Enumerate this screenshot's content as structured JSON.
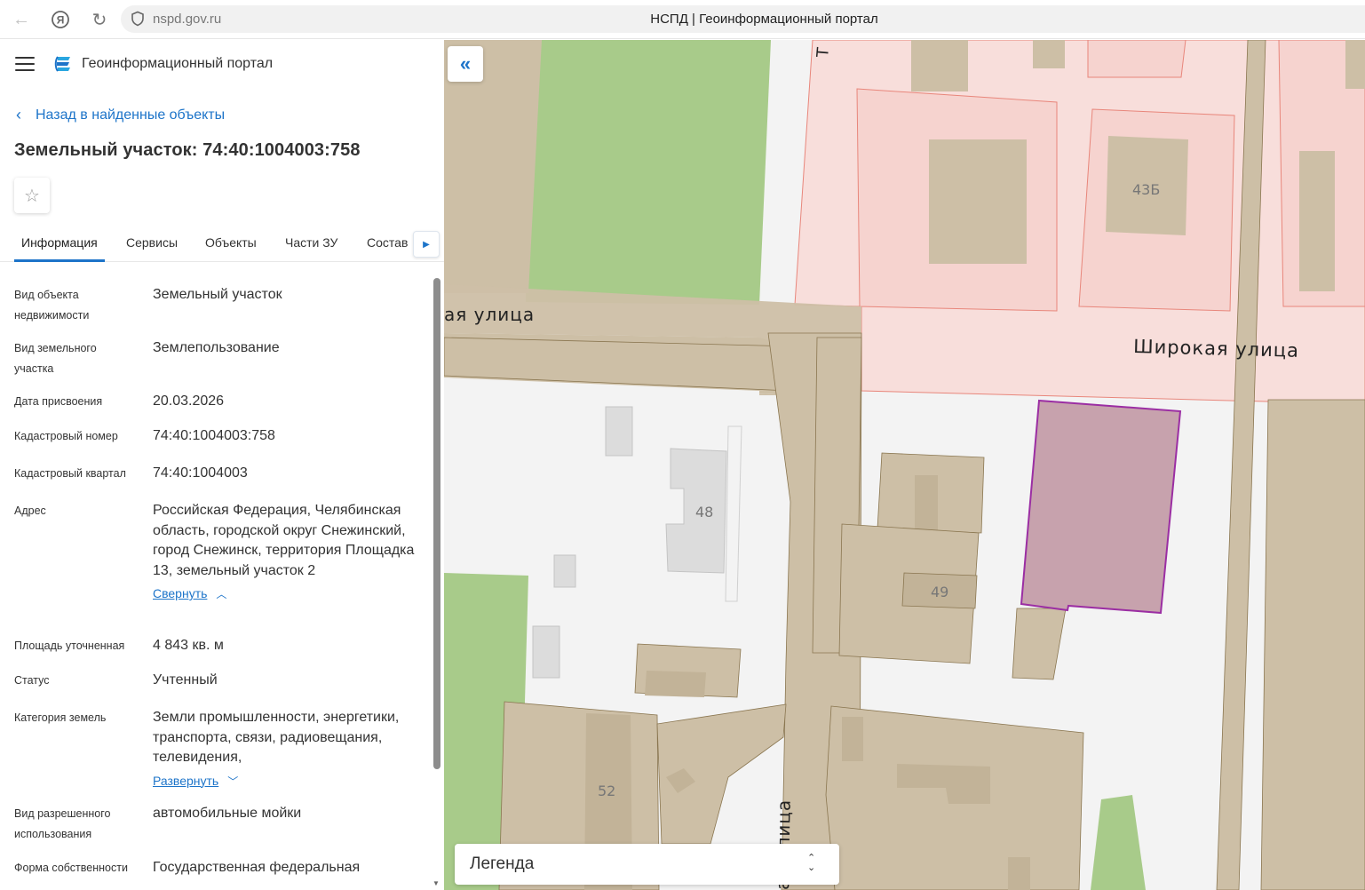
{
  "browser": {
    "url": "nspd.gov.ru",
    "tab_title": "НСПД | Геоинформационный портал"
  },
  "header": {
    "portal_name": "Геоинформационный портал"
  },
  "back_link": "Назад в найденные объекты",
  "object_title": "Земельный участок: 74:40:1004003:758",
  "tabs": [
    {
      "label": "Информация",
      "active": true
    },
    {
      "label": "Сервисы"
    },
    {
      "label": "Объекты"
    },
    {
      "label": "Части ЗУ"
    },
    {
      "label": "Состав"
    }
  ],
  "properties": [
    {
      "label": "Вид объекта недвижимости",
      "value": "Земельный участок"
    },
    {
      "label": "Вид земельного участка",
      "value": "Землепользование"
    },
    {
      "label": "Дата присвоения",
      "value": "20.03.2026"
    },
    {
      "label": "Кадастровый номер",
      "value": "74:40:1004003:758"
    },
    {
      "label": "Кадастровый квартал",
      "value": "74:40:1004003"
    },
    {
      "label": "Адрес",
      "value": "Российская Федерация, Челябинская область, городской округ Снежинский, город Снежинск, территория Площадка 13, земельный участок 2",
      "toggle": "Свернуть"
    },
    {
      "label": "Площадь уточненная",
      "value": "4 843 кв. м"
    },
    {
      "label": "Статус",
      "value": "Учтенный"
    },
    {
      "label": "Категория земель",
      "value": "Земли промышленности, энергетики, транспорта, связи, радиовещания, телевидения,",
      "toggle": "Развернуть"
    },
    {
      "label": "Вид разрешенного использования",
      "value": "автомобильные мойки"
    },
    {
      "label": "Форма собственности",
      "value": "Государственная федеральная"
    }
  ],
  "map": {
    "street_labels": [
      "ая улица",
      "Широкая улица",
      "ая улица",
      "Т"
    ],
    "house_numbers": [
      "43Б",
      "48",
      "49",
      "52"
    ],
    "legend_label": "Легенда"
  },
  "colors": {
    "accent": "#1d74c9",
    "parcel_fill": "#c7a2ad",
    "parcel_stroke": "#9b2ea3",
    "zone_fill": "#f7dcd8",
    "zone_stroke": "#e8867b",
    "building": "#cdbfa6",
    "green": "#a8cb8a"
  }
}
